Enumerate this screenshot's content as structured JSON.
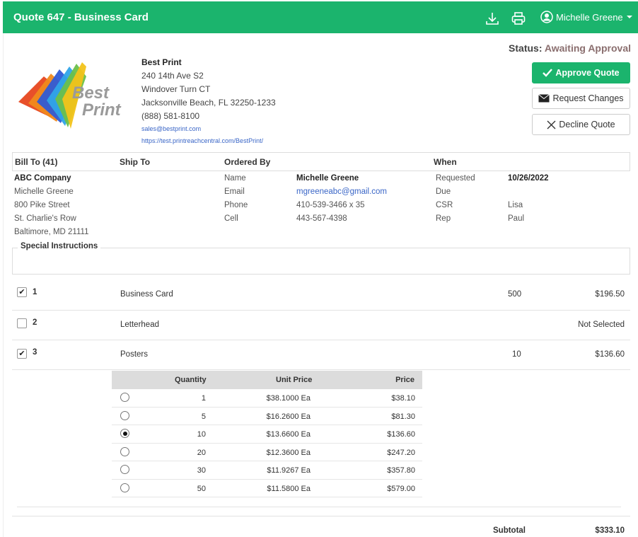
{
  "header": {
    "title": "Quote 647 - Business Card",
    "user_name": "Michelle Greene",
    "download_icon": "download-icon",
    "print_icon": "printer-icon",
    "accent": "#1bb46d"
  },
  "status": {
    "label": "Status:",
    "value": "Awaiting Approval"
  },
  "actions": {
    "approve": "Approve Quote",
    "request": "Request Changes",
    "decline": "Decline Quote"
  },
  "logo": {
    "line1": "Best",
    "line2": "Print"
  },
  "company": {
    "name": "Best Print",
    "address1": "240 14th Ave S2",
    "address2": "Windover Turn CT",
    "city": "Jacksonville Beach, FL 32250-1233",
    "phone": "(888) 581-8100",
    "email": "sales@bestprint.com",
    "url": "https://test.printreachcentral.com/BestPrint/"
  },
  "info_headers": {
    "bill_to": "Bill To (41)",
    "ship_to": "Ship To",
    "ordered_by": "Ordered By",
    "when": "When"
  },
  "bill_to": {
    "company": "ABC Company",
    "name": "Michelle Greene",
    "street": "800 Pike Street",
    "street2": "St. Charlie's Row",
    "city": "Baltimore, MD 21111"
  },
  "ordered_by": {
    "name_label": "Name",
    "name": "Michelle Greene",
    "email_label": "Email",
    "email": "mgreeneabc@gmail.com",
    "phone_label": "Phone",
    "phone": "410-539-3466 x 35",
    "cell_label": "Cell",
    "cell": "443-567-4398"
  },
  "when": {
    "requested_label": "Requested",
    "requested": "10/26/2022",
    "due_label": "Due",
    "due": "",
    "csr_label": "CSR",
    "csr": "Lisa",
    "rep_label": "Rep",
    "rep": "Paul"
  },
  "special_instructions": {
    "label": "Special Instructions",
    "text": ""
  },
  "items": [
    {
      "num": "1",
      "name": "Business Card",
      "qty": "500",
      "price": "$196.50",
      "checked": true
    },
    {
      "num": "2",
      "name": "Letterhead",
      "qty": "",
      "price": "Not Selected",
      "checked": false
    },
    {
      "num": "3",
      "name": "Posters",
      "qty": "10",
      "price": "$136.60",
      "checked": true
    }
  ],
  "qty_table": {
    "headers": {
      "quantity": "Quantity",
      "unit_price": "Unit Price",
      "price": "Price"
    },
    "rows": [
      {
        "quantity": "1",
        "unit_price": "$38.1000 Ea",
        "price": "$38.10",
        "selected": false
      },
      {
        "quantity": "5",
        "unit_price": "$16.2600 Ea",
        "price": "$81.30",
        "selected": false
      },
      {
        "quantity": "10",
        "unit_price": "$13.6600 Ea",
        "price": "$136.60",
        "selected": true
      },
      {
        "quantity": "20",
        "unit_price": "$12.3600 Ea",
        "price": "$247.20",
        "selected": false
      },
      {
        "quantity": "30",
        "unit_price": "$11.9267 Ea",
        "price": "$357.80",
        "selected": false
      },
      {
        "quantity": "50",
        "unit_price": "$11.5800 Ea",
        "price": "$579.00",
        "selected": false
      }
    ]
  },
  "subtotal": {
    "label": "Subtotal",
    "value": "$333.10"
  }
}
